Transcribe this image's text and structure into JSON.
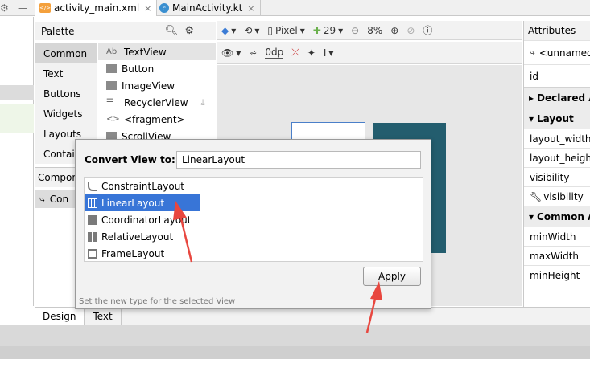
{
  "editor_tabs": [
    {
      "label": "activity_main.xml",
      "icon": "xml-file-icon",
      "active": true
    },
    {
      "label": "MainActivity.kt",
      "icon": "kotlin-file-icon",
      "active": false
    }
  ],
  "palette": {
    "title": "Palette",
    "categories": [
      "Common",
      "Text",
      "Buttons",
      "Widgets",
      "Layouts",
      "Contain"
    ],
    "selected_category": "Common",
    "items": [
      {
        "label": "TextView",
        "icon": "textview-icon"
      },
      {
        "label": "Button",
        "icon": "button-icon"
      },
      {
        "label": "ImageView",
        "icon": "imageview-icon"
      },
      {
        "label": "RecyclerView",
        "icon": "recyclerview-icon"
      },
      {
        "label": "<fragment>",
        "icon": "fragment-icon"
      },
      {
        "label": "ScrollView",
        "icon": "scrollview-icon"
      }
    ]
  },
  "component_tree": {
    "title": "Compon",
    "root_label": "Con"
  },
  "toolbar": {
    "device": "Pixel",
    "api": "29",
    "zoom": "8%",
    "margin": "0dp"
  },
  "attributes": {
    "title": "Attributes",
    "component": "<unnamed",
    "id_label": "id",
    "sections": {
      "declared": "Declared A",
      "layout": "Layout",
      "common": "Common A"
    },
    "layout_rows": [
      "layout_width",
      "layout_height",
      "visibility",
      "visibility"
    ],
    "common_rows": [
      "minWidth",
      "maxWidth",
      "minHeight"
    ]
  },
  "bottom_tabs": [
    "Design",
    "Text"
  ],
  "dialog": {
    "label": "Convert View to:",
    "input_value": "LinearLayout",
    "options": [
      "ConstraintLayout",
      "LinearLayout",
      "CoordinatorLayout",
      "RelativeLayout",
      "FrameLayout"
    ],
    "selected": "LinearLayout",
    "apply_label": "Apply",
    "hint": "Set the new type for the selected View"
  },
  "colors": {
    "selection": "#3875d7",
    "canvas_panel": "#235d6e",
    "annotation_arrow": "#e8473f"
  }
}
